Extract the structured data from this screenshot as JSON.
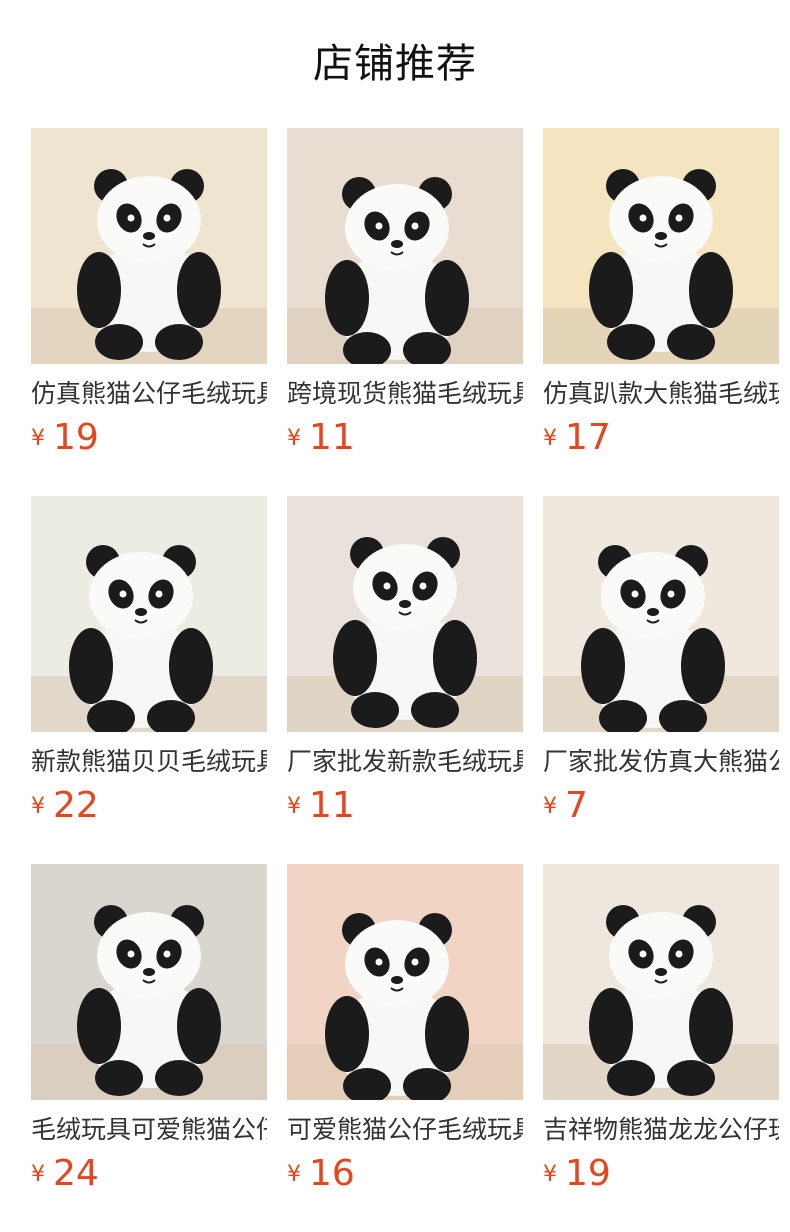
{
  "header": {
    "title": "店铺推荐"
  },
  "products": [
    {
      "name": "仿真熊猫公仔毛绒玩具",
      "currency": "¥",
      "price": "19",
      "bg": "#efe4d0"
    },
    {
      "name": "跨境现货熊猫毛绒玩具",
      "currency": "¥",
      "price": "11",
      "bg": "#e8ddd0"
    },
    {
      "name": "仿真趴款大熊猫毛绒玩具",
      "currency": "¥",
      "price": "17",
      "bg": "#f4e4bf"
    },
    {
      "name": "新款熊猫贝贝毛绒玩具",
      "currency": "¥",
      "price": "22",
      "bg": "#ecece4"
    },
    {
      "name": "厂家批发新款毛绒玩具",
      "currency": "¥",
      "price": "11",
      "bg": "#e9e2dc"
    },
    {
      "name": "厂家批发仿真大熊猫公仔",
      "currency": "¥",
      "price": "7",
      "bg": "#efe8df"
    },
    {
      "name": "毛绒玩具可爱熊猫公仔",
      "currency": "¥",
      "price": "24",
      "bg": "#d9d6d0"
    },
    {
      "name": "可爱熊猫公仔毛绒玩具",
      "currency": "¥",
      "price": "16",
      "bg": "#f1d4c3"
    },
    {
      "name": "吉祥物熊猫龙龙公仔玩具",
      "currency": "¥",
      "price": "19",
      "bg": "#eee7de"
    }
  ]
}
